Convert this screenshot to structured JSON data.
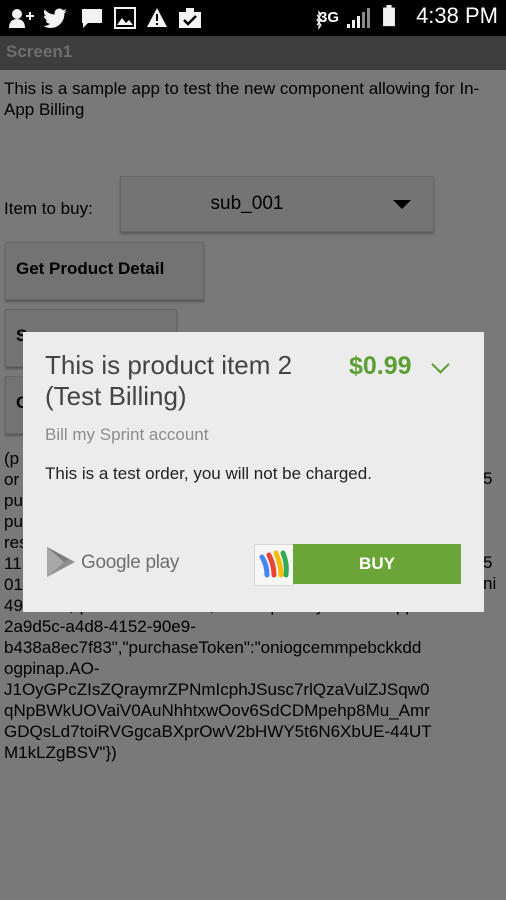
{
  "status_bar": {
    "network": "3G",
    "time": "4:38 PM",
    "icons": [
      "add-contact-icon",
      "twitter-icon",
      "message-icon",
      "gallery-icon",
      "warning-icon",
      "clipboard-check-icon",
      "bluetooth-icon",
      "signal-icon",
      "battery-icon"
    ]
  },
  "app": {
    "title": "Screen1",
    "intro": "This is a sample app to test the new component allowing for In-App Billing",
    "item_label": "Item to buy:",
    "item_select": {
      "selected": "sub_001"
    },
    "buttons": {
      "get_product_detail": "Get Product Detail",
      "button2_partial": "S",
      "button3_partial": "C"
    },
    "response_lines": [
      "(p",
      "or",
      "pu",
      "pu",
      "res",
      "11",
      "01",
      "4973811,\"purchaseState\":0,\"developerPayload\":\"inapp:50",
      "2a9d5c-a4d8-4152-90e9-",
      "b438a8ec7f83\",\"purchaseToken\":\"oniogcemmpebckkdd",
      "ogpinap.AO-",
      "J1OyGPcZIsZQraymrZPNmIcphJSusc7rlQzaVulZJSqw0",
      "qNpBWkUOVaiV0AuNhhtxwOov6SdCDMpehp8Mu_Amr",
      "GDQsLd7toiRVGgcaBXprOwV2bHWY5t6N6XbUE-44UT",
      "M1kLZgBSV\"})"
    ],
    "response_right_fragments": [
      "5",
      "5",
      "ni"
    ]
  },
  "dialog": {
    "title": "This is product item 2 (Test Billing)",
    "price": "$0.99",
    "billing_method": "Bill my Sprint account",
    "note": "This is a test order, you will not be charged.",
    "brand": "Google play",
    "buy_label": "BUY",
    "colors": {
      "accent_green": "#6ca537",
      "price_green": "#5b9e33"
    }
  }
}
